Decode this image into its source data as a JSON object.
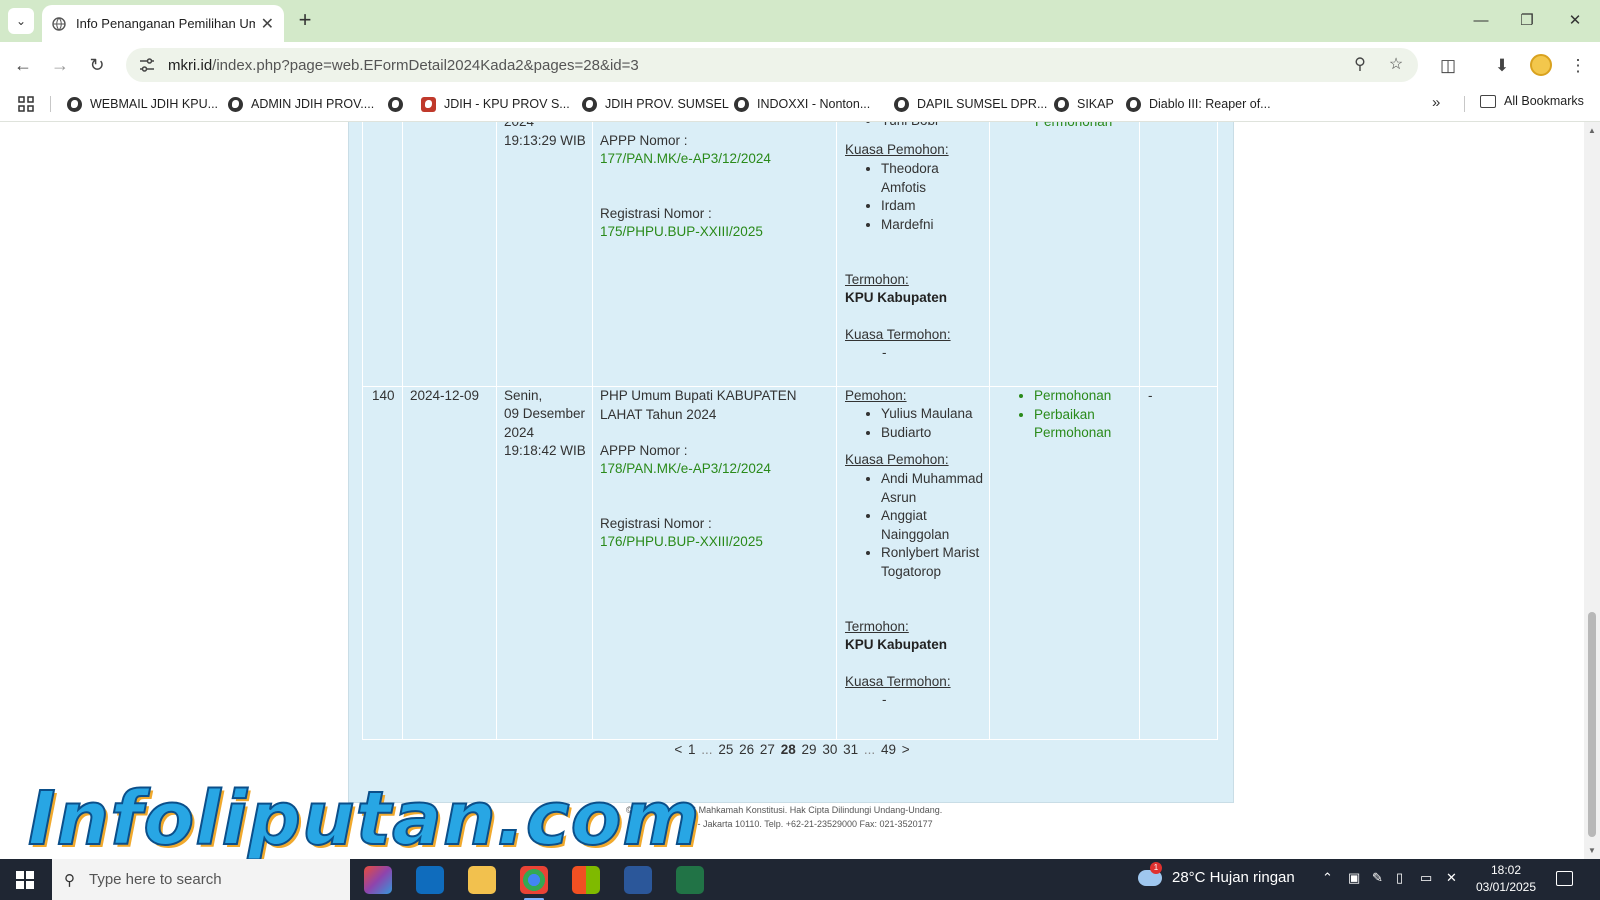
{
  "browser": {
    "tab_title": "Info Penanganan Pemilihan Um",
    "url_host": "mkri.id",
    "url_path": "/index.php?page=web.EFormDetail2024Kada2&pages=28&id=3",
    "bookmarks": [
      "WEBMAIL JDIH KPU...",
      "ADMIN JDIH PROV....",
      "",
      "JDIH - KPU PROV S...",
      "JDIH PROV. SUMSEL",
      "INDOXXI - Nonton...",
      "DAPIL SUMSEL DPR...",
      "SIKAP",
      "Diablo III: Reaper of..."
    ],
    "all_bookmarks": "All Bookmarks"
  },
  "rows": [
    {
      "date_part": "2024",
      "time": "19:13:29 WIB",
      "appp_label": "APPP Nomor :",
      "appp_no": "177/PAN.MK/e-AP3/12/2024",
      "reg_label": "Registrasi Nomor :",
      "reg_no": "175/PHPU.BUP-XXIII/2025",
      "pemohon_tail": "Yuni Bobi",
      "kuasa_pemohon_label": "Kuasa Pemohon:",
      "kuasa_pemohon": [
        "Theodora Amfotis",
        "Irdam",
        "Mardefni"
      ],
      "termohon_label": "Termohon:",
      "termohon": "KPU Kabupaten",
      "kuasa_termohon_label": "Kuasa Termohon:",
      "kuasa_termohon": "-",
      "doc_tail": "Permohonan"
    },
    {
      "no": "140",
      "tanggal": "2024-12-09",
      "hari": "Senin,",
      "tgl_lengkap": "09 Desember 2024",
      "time": "19:18:42 WIB",
      "perkara": "PHP Umum Bupati KABUPATEN LAHAT Tahun 2024",
      "appp_label": "APPP Nomor :",
      "appp_no": "178/PAN.MK/e-AP3/12/2024",
      "reg_label": "Registrasi Nomor :",
      "reg_no": "176/PHPU.BUP-XXIII/2025",
      "pemohon_label": "Pemohon:",
      "pemohon": [
        "Yulius Maulana",
        "Budiarto"
      ],
      "kuasa_pemohon_label": "Kuasa Pemohon:",
      "kuasa_pemohon": [
        "Andi Muhammad Asrun",
        "Anggiat Nainggolan",
        "Ronlybert Marist Togatorop"
      ],
      "termohon_label": "Termohon:",
      "termohon": "KPU Kabupaten",
      "kuasa_termohon_label": "Kuasa Termohon:",
      "kuasa_termohon": "-",
      "docs": [
        "Permohonan",
        "Perbaikan Permohonan"
      ],
      "ket": "-"
    }
  ],
  "pager": {
    "prev": "<",
    "first": "1",
    "dots": "...",
    "pages": [
      "25",
      "26",
      "27"
    ],
    "current": "28",
    "pages_after": [
      "29",
      "30",
      "31"
    ],
    "last": "49",
    "next": ">"
  },
  "footer": {
    "line1": "© Copyright 2016 Mahkamah Konstitusi. Hak Cipta Dilindungi Undang-Undang.",
    "line2": "6 - Jakarta 10110. Telp. +62-21-23529000 Fax: 021-3520177"
  },
  "watermark": "Infoliputan.com",
  "taskbar": {
    "search_placeholder": "Type here to search",
    "weather": "28°C  Hujan ringan",
    "time": "18:02",
    "date": "03/01/2025"
  },
  "colors": {
    "panel": "#daeef7",
    "link": "#2a8a1a",
    "titlebar": "#d3e9c9",
    "taskbar": "#1f2633"
  }
}
